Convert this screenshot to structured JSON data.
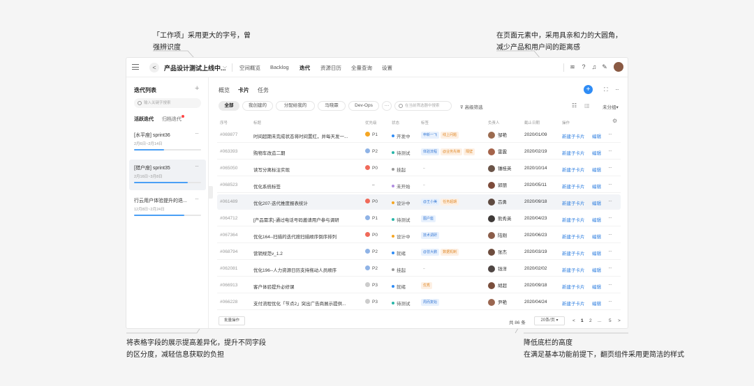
{
  "annotations": {
    "top_left": [
      "「工作项」采用更大的字号，曾",
      "强辨识度"
    ],
    "top_right": [
      "在页面元素中，采用具亲和力的大圆角，",
      "减少产品和用户间的距离感"
    ],
    "bottom_left": [
      "将表格字段的展示提高差异化，提升不同字段",
      "的区分度，减轻信息获取的负担"
    ],
    "bottom_right": [
      "降低底栏的高度",
      "在满足基本功能前提下，翻页组件采用更简洁的样式"
    ]
  },
  "topbar": {
    "menu_icon": "hamburger-icon",
    "back_label": "<",
    "project": "产品设计测试上线中...",
    "project_chevron": "⌵",
    "nav": [
      "空间概览",
      "Backlog",
      "迭代",
      "资源日历",
      "全量查询",
      "设置"
    ],
    "active_nav": "迭代",
    "icons": [
      "layers-icon",
      "help-icon",
      "bell-icon",
      "pen-icon"
    ]
  },
  "sidebar": {
    "title": "迭代列表",
    "add": "+",
    "search_placeholder": "输入关键字搜索",
    "tabs": [
      "活跃迭代",
      "归档迭代"
    ],
    "sprints": [
      {
        "name": "[水平座] sprint36",
        "date": "2月6日~2月14日",
        "progress": 0.45,
        "more": "···"
      },
      {
        "name": "[猎户座] sprint35",
        "date": "2月16日~3月8日",
        "progress": 0.8,
        "more": "···"
      },
      {
        "name": "行云用户体验提升的迭...",
        "date": "12月8日~2月24日",
        "progress": 0.75,
        "more": "···"
      }
    ]
  },
  "main": {
    "view_tabs": [
      "概览",
      "卡片",
      "任务"
    ],
    "active_view": "卡片",
    "add": "+",
    "expand_icon": "⛶",
    "more": "···",
    "chips": [
      "全部",
      "我创建的",
      "分配给我的",
      "马晓霖",
      "Dev-Ops",
      "···"
    ],
    "filter_placeholder": "在当前筛选器中搜索",
    "advanced_filter": "高级筛选",
    "ungroup": "未分组",
    "ungroup_chevron": "▾",
    "columns": [
      "序号",
      "标题",
      "优先级",
      "状态",
      "标签",
      "负责人",
      "截止日期",
      "操作"
    ],
    "settings_icon": "⚙"
  },
  "rows": [
    {
      "id": "#069877",
      "title": "时间超期未完成状态将时间置红，并每天发一...",
      "pri": "P1",
      "pri_color": "#f5a623",
      "status": "开发中",
      "st_color": "#2f8cf5",
      "tags": [
        {
          "t": "申新一飞",
          "c": "#e8f1fd",
          "f": "#3a7bd5"
        },
        {
          "t": "线上问题",
          "c": "#fdf0e4",
          "f": "#e08a2b"
        }
      ],
      "owner": "邹艳",
      "av": "#9b6b4f",
      "date": "2020/01/09",
      "act1": "新建子卡片",
      "act2": "编辑",
      "more": "···"
    },
    {
      "id": "#063393",
      "title": "购物车改造二期",
      "pri": "P2",
      "pri_color": "#8fb3e6",
      "status": "待测试",
      "st_color": "#29b6a8",
      "tags": [
        {
          "t": "体验流程",
          "c": "#e8f1fd",
          "f": "#3a7bd5"
        },
        {
          "t": "@业务先锋",
          "c": "#fdf0e4",
          "f": "#e08a2b"
        },
        {
          "t": "隔壁",
          "c": "#fdf0e4",
          "f": "#e08a2b"
        }
      ],
      "owner": "雷震",
      "av": "#a4634a",
      "date": "2020/02/19",
      "act1": "新建子卡片",
      "act2": "编辑",
      "more": "···"
    },
    {
      "id": "#065050",
      "title": "读写分离标注实现",
      "pri": "P0",
      "pri_color": "#f06a5a",
      "status": "挂起",
      "st_color": "#999999",
      "tags": [
        {
          "t": "–",
          "c": "transparent",
          "f": "#999"
        }
      ],
      "owner": "锺桂英",
      "av": "#6b5448",
      "date": "2020/10/14",
      "act1": "新建子卡片",
      "act2": "编辑",
      "more": "···"
    },
    {
      "id": "#068523",
      "title": "优化系统标签",
      "pri": "–",
      "pri_color": "transparent",
      "status": "未开始",
      "st_color": "#b08de0",
      "tags": [
        {
          "t": "–",
          "c": "transparent",
          "f": "#999"
        }
      ],
      "owner": "郭朋",
      "av": "#7d4b3a",
      "date": "2020/05/11",
      "act1": "新建子卡片",
      "act2": "编辑",
      "more": "···"
    },
    {
      "id": "#061489",
      "title": "优化207-迭代推度报表统计",
      "pri": "P0",
      "pri_color": "#f06a5a",
      "status": "设计中",
      "st_color": "#f5a623",
      "tags": [
        {
          "t": "@王小美",
          "c": "#e8f1fd",
          "f": "#3a7bd5"
        },
        {
          "t": "任务超期",
          "c": "#fdf0e4",
          "f": "#e08a2b"
        }
      ],
      "owner": "吕勇",
      "av": "#5e4a40",
      "date": "2020/09/18",
      "act1": "新建子卡片",
      "act2": "编辑",
      "more": "···"
    },
    {
      "id": "#064712",
      "title": "[产品需求]-通过电话号码邀请用户参与调研",
      "pri": "P1",
      "pri_color": "#8fb3e6",
      "status": "待测试",
      "st_color": "#29b6a8",
      "tags": [
        {
          "t": "图户座",
          "c": "#e8f1fd",
          "f": "#3a7bd5"
        }
      ],
      "owner": "熊秀英",
      "av": "#3f3a38",
      "date": "2020/04/23",
      "act1": "新建子卡片",
      "act2": "编辑",
      "more": "···"
    },
    {
      "id": "#067364",
      "title": "优化164--扫描的迭代按扫描顺序倒序排列",
      "pri": "P0",
      "pri_color": "#f06a5a",
      "status": "设计中",
      "st_color": "#f5a623",
      "tags": [
        {
          "t": "技术调研",
          "c": "#e8f1fd",
          "f": "#3a7bd5"
        }
      ],
      "owner": "陆刚",
      "av": "#8b5d49",
      "date": "2020/06/23",
      "act1": "新建子卡片",
      "act2": "编辑",
      "more": "···"
    },
    {
      "id": "#068794",
      "title": "营销规范v_1.2",
      "pri": "P2",
      "pri_color": "#8fb3e6",
      "status": "就绪",
      "st_color": "#2f8cf5",
      "tags": [
        {
          "t": "@曾大鹏",
          "c": "#e8f1fd",
          "f": "#3a7bd5"
        },
        {
          "t": "数据机制",
          "c": "#fdf0e4",
          "f": "#e08a2b"
        }
      ],
      "owner": "张杰",
      "av": "#6d4c3d",
      "date": "2020/03/19",
      "act1": "新建子卡片",
      "act2": "编辑",
      "more": "···"
    },
    {
      "id": "#062081",
      "title": "优化196--人力资源日历支持拖动人员顺序",
      "pri": "P2",
      "pri_color": "#8fb3e6",
      "status": "挂起",
      "st_color": "#999999",
      "tags": [
        {
          "t": "–",
          "c": "transparent",
          "f": "#999"
        }
      ],
      "owner": "钱洋",
      "av": "#4f4643",
      "date": "2020/02/02",
      "act1": "新建子卡片",
      "act2": "编辑",
      "more": "···"
    },
    {
      "id": "#066913",
      "title": "客户体验提升必修课",
      "pri": "P3",
      "pri_color": "#cccccc",
      "status": "就绪",
      "st_color": "#2f8cf5",
      "tags": [
        {
          "t": "优秀",
          "c": "#fdf0e4",
          "f": "#e08a2b"
        }
      ],
      "owner": "胡超",
      "av": "#7a4e3c",
      "date": "2020/09/18",
      "act1": "新建子卡片",
      "act2": "编辑",
      "more": "···"
    },
    {
      "id": "#066228",
      "title": "支付流程优化「节点2」突出广告商展示提供...",
      "pri": "P3",
      "pri_color": "#cccccc",
      "status": "待测试",
      "st_color": "#29b6a8",
      "tags": [
        {
          "t": "周而复始",
          "c": "#e8f1fd",
          "f": "#3a7bd5"
        }
      ],
      "owner": "尹艳",
      "av": "#9a6650",
      "date": "2020/04/24",
      "act1": "新建子卡片",
      "act2": "编辑",
      "more": "···"
    }
  ],
  "footer": {
    "batch": "批量操作",
    "total": "共 86 条",
    "per_page": "20条/页 ▾",
    "pages": [
      "<",
      "1",
      "2",
      "...",
      "5",
      ">"
    ],
    "current_page": "1"
  }
}
